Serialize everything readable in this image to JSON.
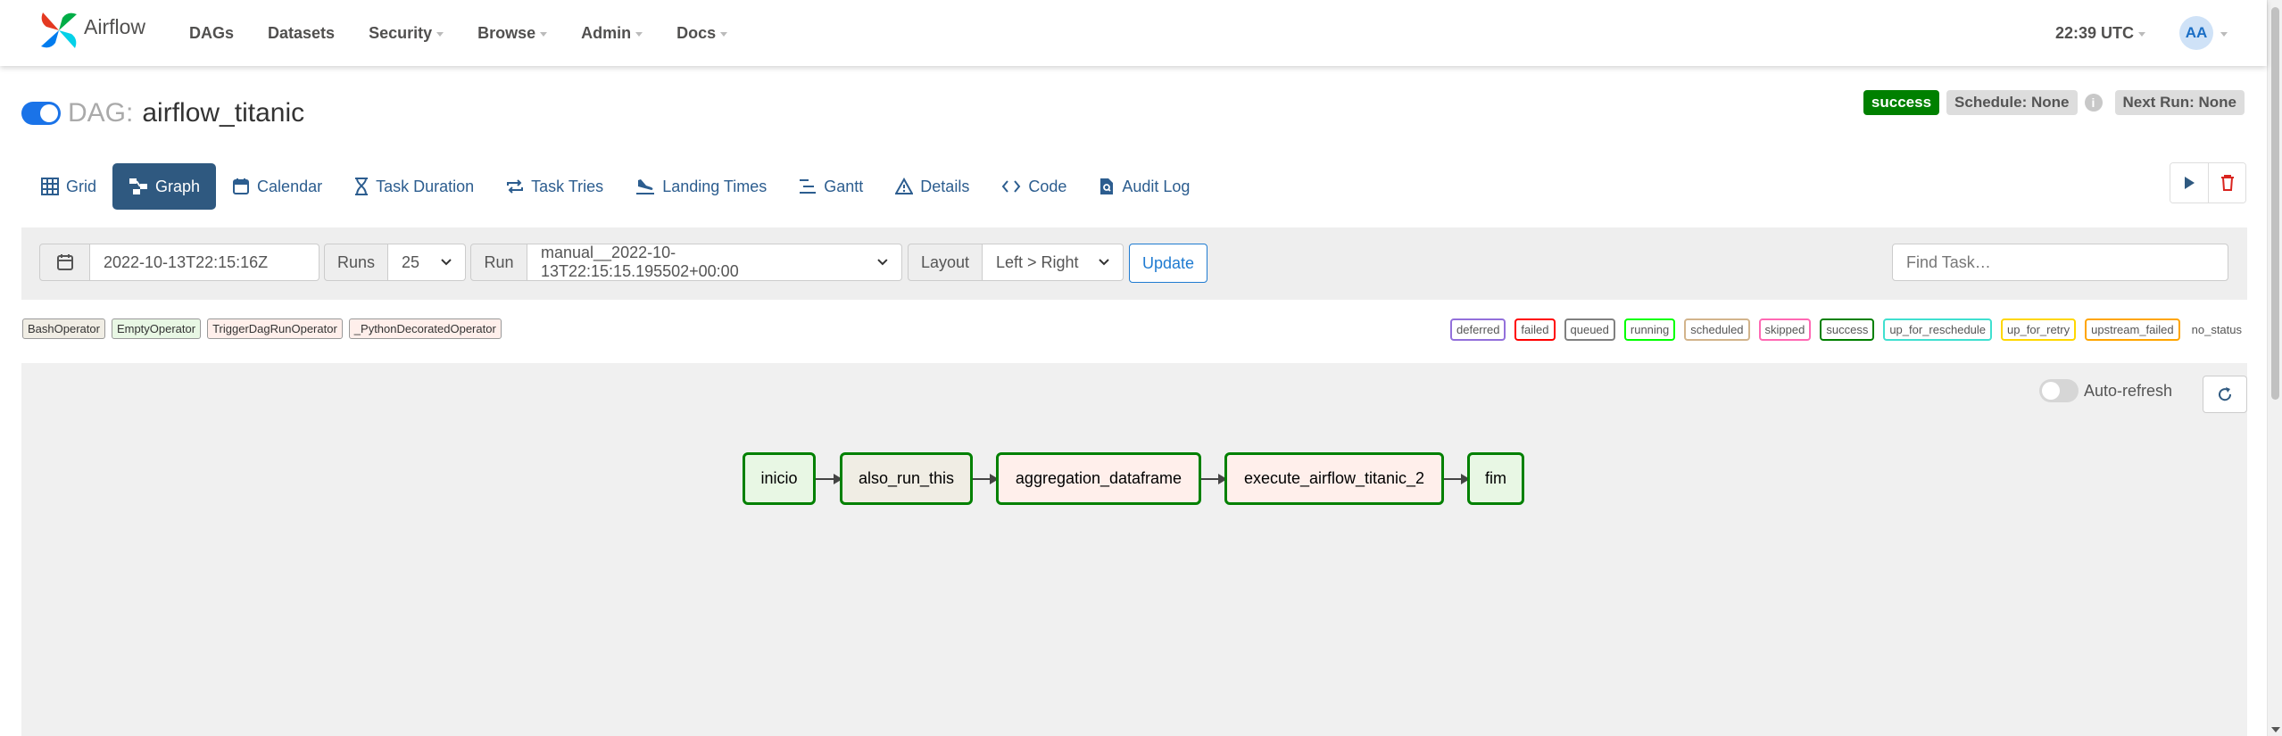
{
  "brand": {
    "name": "Airflow"
  },
  "nav": {
    "items": [
      {
        "label": "DAGs",
        "dropdown": false
      },
      {
        "label": "Datasets",
        "dropdown": false
      },
      {
        "label": "Security",
        "dropdown": true
      },
      {
        "label": "Browse",
        "dropdown": true
      },
      {
        "label": "Admin",
        "dropdown": true
      },
      {
        "label": "Docs",
        "dropdown": true
      }
    ],
    "clock": "22:39 UTC",
    "avatar": "AA"
  },
  "dag": {
    "prefix": "DAG:",
    "name": "airflow_titanic",
    "paused": false,
    "status": "success",
    "schedule": "Schedule: None",
    "next_run": "Next Run: None"
  },
  "tabs": [
    {
      "label": "Grid",
      "icon": "grid-icon",
      "active": false
    },
    {
      "label": "Graph",
      "icon": "graph-icon",
      "active": true
    },
    {
      "label": "Calendar",
      "icon": "calendar-icon",
      "active": false
    },
    {
      "label": "Task Duration",
      "icon": "hourglass-icon",
      "active": false
    },
    {
      "label": "Task Tries",
      "icon": "retry-icon",
      "active": false
    },
    {
      "label": "Landing Times",
      "icon": "plane-landing-icon",
      "active": false
    },
    {
      "label": "Gantt",
      "icon": "gantt-icon",
      "active": false
    },
    {
      "label": "Details",
      "icon": "warning-triangle-icon",
      "active": false
    },
    {
      "label": "Code",
      "icon": "code-icon",
      "active": false
    },
    {
      "label": "Audit Log",
      "icon": "file-search-icon",
      "active": false
    }
  ],
  "toolbar": {
    "date": "2022-10-13T22:15:16Z",
    "runs_label": "Runs",
    "runs_value": "25",
    "run_label": "Run",
    "run_value": "manual__2022-10-13T22:15:15.195502+00:00",
    "layout_label": "Layout",
    "layout_value": "Left > Right",
    "update_label": "Update",
    "find_placeholder": "Find Task…"
  },
  "operators": [
    {
      "label": "BashOperator",
      "color": "#f0ede4"
    },
    {
      "label": "EmptyOperator",
      "color": "#e8f7e4"
    },
    {
      "label": "TriggerDagRunOperator",
      "color": "#ffefeb"
    },
    {
      "label": "_PythonDecoratedOperator",
      "color": "#ffefeb"
    }
  ],
  "states": [
    {
      "label": "deferred",
      "color": "#9370db"
    },
    {
      "label": "failed",
      "color": "#ff0000"
    },
    {
      "label": "queued",
      "color": "#808080"
    },
    {
      "label": "running",
      "color": "#00ff00"
    },
    {
      "label": "scheduled",
      "color": "#d2b48c"
    },
    {
      "label": "skipped",
      "color": "#ff69b4"
    },
    {
      "label": "success",
      "color": "#008000"
    },
    {
      "label": "up_for_reschedule",
      "color": "#40e0d0"
    },
    {
      "label": "up_for_retry",
      "color": "#ffd700"
    },
    {
      "label": "upstream_failed",
      "color": "#ffa500"
    },
    {
      "label": "no_status",
      "color": ""
    }
  ],
  "graph": {
    "autorefresh_label": "Auto-refresh",
    "autorefresh_on": false,
    "nodes": [
      {
        "label": "inicio",
        "operator": "EmptyOperator",
        "state": "success"
      },
      {
        "label": "also_run_this",
        "operator": "BashOperator",
        "state": "success"
      },
      {
        "label": "aggregation_dataframe",
        "operator": "_PythonDecoratedOperator",
        "state": "success"
      },
      {
        "label": "execute_airflow_titanic_2",
        "operator": "TriggerDagRunOperator",
        "state": "success"
      },
      {
        "label": "fim",
        "operator": "EmptyOperator",
        "state": "success"
      }
    ]
  },
  "colors": {
    "accent": "#2f5980",
    "link": "#2c5d8f",
    "success": "#008000",
    "toggle_on": "#1a73e8"
  }
}
